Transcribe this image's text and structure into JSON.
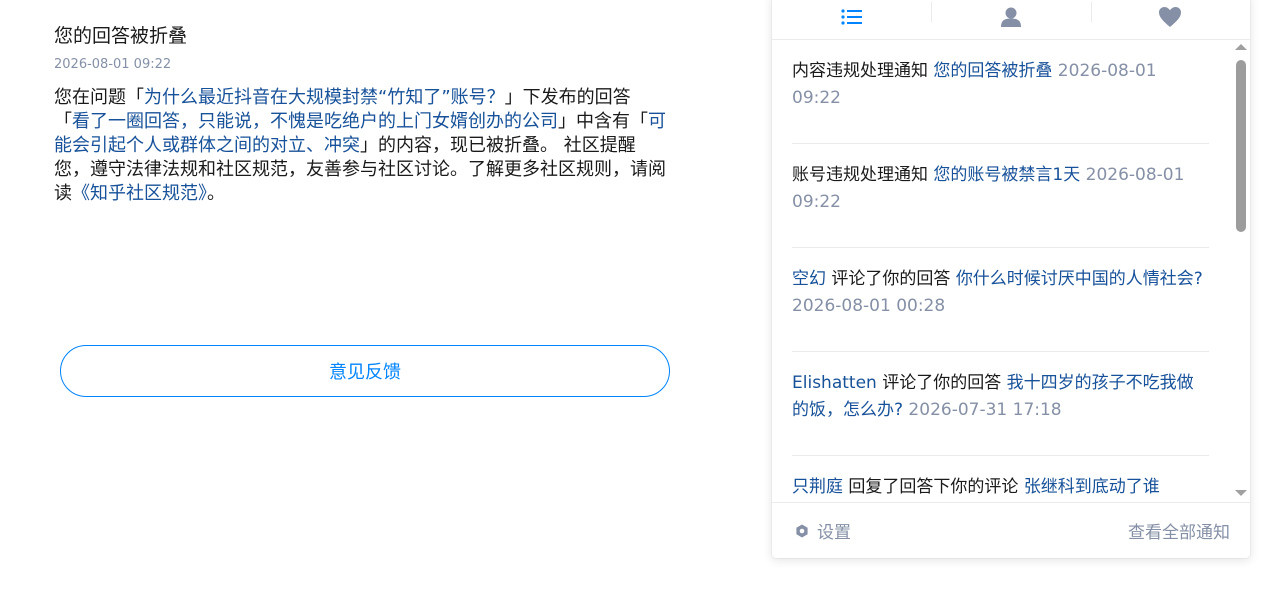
{
  "message": {
    "title": "您的回答被折叠",
    "time": "2026-08-01 09:22",
    "body": {
      "p1": "您在问题「",
      "question_link": "为什么最近抖音在大规模封禁“竹知了”账号？",
      "p2": "」下发布的回答「",
      "answer_link": "看了一圈回答，只能说，不愧是吃绝户的上门女婿创办的公司",
      "p3": "」中含有「",
      "reason_link": "可能会引起个人或群体之间的对立、冲突",
      "p4": "」的内容，现已被折叠。 社区提醒您，遵守法律法规和社区规范，友善参与社区讨论。了解更多社区规则，请阅读",
      "rules_link": "《知乎社区规范》",
      "p5": "。"
    },
    "feedback_label": "意见反馈"
  },
  "panel": {
    "tab_icons": [
      "list-icon",
      "user-icon",
      "heart-icon"
    ],
    "notifications": [
      {
        "prefix": " 内容违规处理通知 ",
        "link": "您的回答被折叠",
        "time": " 2026-08-01 09:22"
      },
      {
        "prefix": " 账号违规处理通知 ",
        "link": "您的账号被禁言1天",
        "time": " 2026-08-01 09:22"
      },
      {
        "actor": "空幻",
        "action": " 评论了你的回答 ",
        "link": "你什么时候讨厌中国的人情社会?",
        "time": "  2026-08-01 00:28"
      },
      {
        "actor": "Elishatten",
        "action": " 评论了你的回答 ",
        "link": "我十四岁的孩子不吃我做的饭，怎么办?",
        "time": "  2026-07-31 17:18"
      },
      {
        "actor": "只荆庭",
        "action": " 回复了回答下你的评论 ",
        "link": "张继科到底动了谁",
        "time": ""
      }
    ],
    "settings_label": "设置",
    "view_all_label": "查看全部通知"
  },
  "colors": {
    "link": "#175199",
    "muted": "#8590a6",
    "accent": "#0084ff"
  }
}
